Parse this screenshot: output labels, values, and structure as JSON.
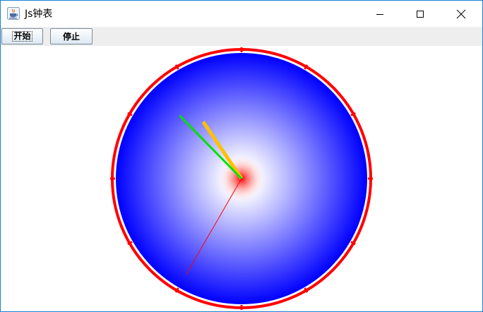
{
  "window": {
    "title": "Js钟表",
    "app_icon": "java-cup-icon",
    "controls": {
      "minimize_icon": "minimize-icon",
      "maximize_icon": "maximize-icon",
      "close_icon": "close-icon"
    }
  },
  "toolbar": {
    "start_label": "开始",
    "stop_label": "停止"
  },
  "clock": {
    "time": {
      "hours": 10,
      "minutes": 52,
      "seconds": 35
    },
    "hand_colors": {
      "hour": "#ffc000",
      "minute": "#00e000",
      "second": "#ff0000"
    },
    "rim_color": "#ff0000",
    "face_edge_color": "#0000ff",
    "face_center_color": "#ffffff",
    "hub_color": "#ff0000",
    "tick_count": 12
  }
}
